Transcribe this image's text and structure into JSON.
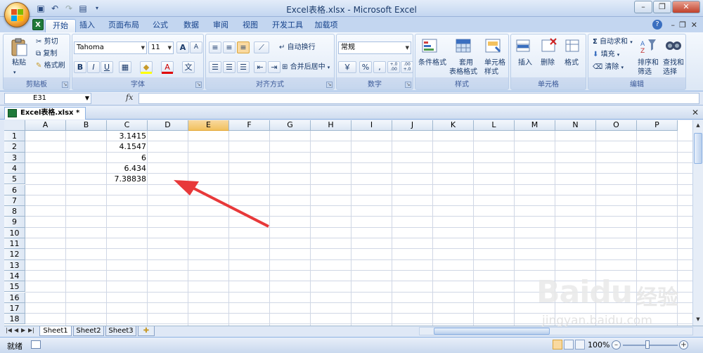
{
  "window": {
    "title": "Excel表格.xlsx - Microsoft Excel"
  },
  "ribbon_tabs": [
    "开始",
    "插入",
    "页面布局",
    "公式",
    "数据",
    "审阅",
    "视图",
    "开发工具",
    "加载项"
  ],
  "clipboard": {
    "paste": "粘贴",
    "cut": "剪切",
    "copy": "复制",
    "painter": "格式刷",
    "name": "剪贴板"
  },
  "font": {
    "family": "Tahoma",
    "size": "11",
    "name": "字体",
    "grow": "A",
    "shrink": "A",
    "bold": "B",
    "italic": "I",
    "underline": "U",
    "font_color": "A",
    "phonetic": "文"
  },
  "alignment": {
    "wrap": "自动换行",
    "merge": "合并后居中",
    "name": "对齐方式"
  },
  "number": {
    "format": "常规",
    "percent": "%",
    "comma": ",",
    "inc": "+.0 .00",
    "dec": ".00 +.0",
    "name": "数字"
  },
  "styles": {
    "conditional": "条件格式",
    "table_1": "套用",
    "table_2": "表格格式",
    "cell_1": "单元格",
    "cell_2": "样式",
    "name": "样式"
  },
  "cells": {
    "insert": "插入",
    "delete": "删除",
    "format": "格式",
    "name": "单元格"
  },
  "editing": {
    "autosum": "自动求和",
    "fill": "填充",
    "clear": "清除",
    "sort_1": "排序和",
    "sort_2": "筛选",
    "find_1": "查找和",
    "find_2": "选择",
    "name": "编辑"
  },
  "formula_bar": {
    "name_box": "E31",
    "fx": "fx",
    "value": ""
  },
  "workbook": {
    "tab": "Excel表格.xlsx *"
  },
  "columns": [
    "A",
    "B",
    "C",
    "D",
    "E",
    "F",
    "G",
    "H",
    "I",
    "J",
    "K",
    "L",
    "M",
    "N",
    "O",
    "P"
  ],
  "rows": [
    "1",
    "2",
    "3",
    "4",
    "5",
    "6",
    "7",
    "8",
    "9",
    "10",
    "11",
    "12",
    "13",
    "14",
    "15",
    "16",
    "17",
    "18"
  ],
  "cells_data": [
    {
      "ref": "C1",
      "value": "3.1415"
    },
    {
      "ref": "C2",
      "value": "4.1547"
    },
    {
      "ref": "C3",
      "value": "6"
    },
    {
      "ref": "C4",
      "value": "6.434"
    },
    {
      "ref": "C5",
      "value": "7.38838"
    }
  ],
  "sheets": [
    "Sheet1",
    "Sheet2",
    "Sheet3"
  ],
  "status": {
    "ready": "就绪",
    "zoom": "100%"
  },
  "watermark": {
    "brand": "Bai",
    "brand2": "du",
    "brand_cn": "经验",
    "url": "jingyan.baidu.com"
  },
  "colors": {
    "selected_header": "#f1c15f",
    "annotation_arrow": "#e8393a"
  }
}
